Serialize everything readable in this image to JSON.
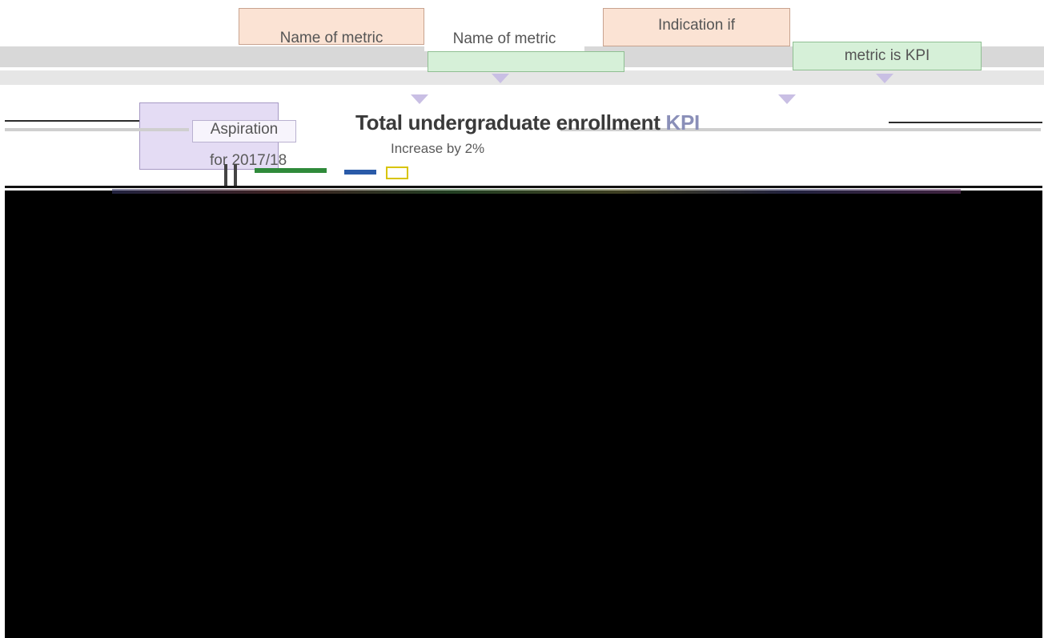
{
  "callouts": {
    "name_of_metric_top": "Name of metric",
    "name_of_metric": "Name of metric",
    "indication_if": "Indication if",
    "metric_is_kpi": "metric is KPI",
    "aspiration": "Aspiration",
    "aspiration_year": "for 2017/18"
  },
  "metric": {
    "title": "Total undergraduate enrollment",
    "kpi_tag": "KPI",
    "status": "Increase by 2%"
  },
  "colors": {
    "peach": "#fbe3d4",
    "lavender": "#e4dcf4",
    "green": "#d6f0d8",
    "black_panel": "#000000"
  }
}
